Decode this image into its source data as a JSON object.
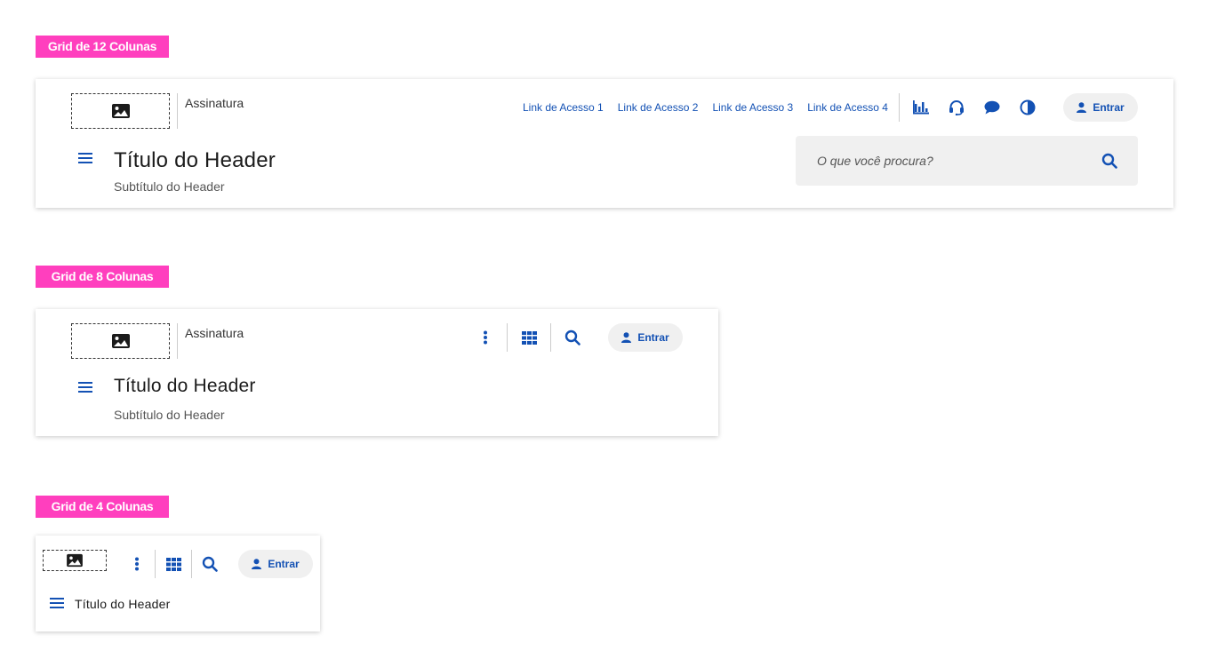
{
  "colors": {
    "tag_bg": "#ff3fbe",
    "primary": "#1351b4",
    "pill_bg": "#f0f0f0"
  },
  "sections": {
    "grid12": {
      "tag": "Grid de 12 Colunas",
      "signature": "Assinatura",
      "title": "Título do Header",
      "subtitle": "Subtítulo do Header",
      "links": [
        "Link de Acesso 1",
        "Link de Acesso 2",
        "Link de Acesso 3",
        "Link de Acesso 4"
      ],
      "functions": [
        "chart-icon",
        "headset-icon",
        "chat-icon",
        "contrast-icon"
      ],
      "login": "Entrar",
      "search_placeholder": "O que você procura?"
    },
    "grid8": {
      "tag": "Grid de 8 Colunas",
      "signature": "Assinatura",
      "title": "Título do Header",
      "subtitle": "Subtítulo do Header",
      "login": "Entrar"
    },
    "grid4": {
      "tag": "Grid de 4 Colunas",
      "title": "Título do Header",
      "login": "Entrar"
    }
  }
}
